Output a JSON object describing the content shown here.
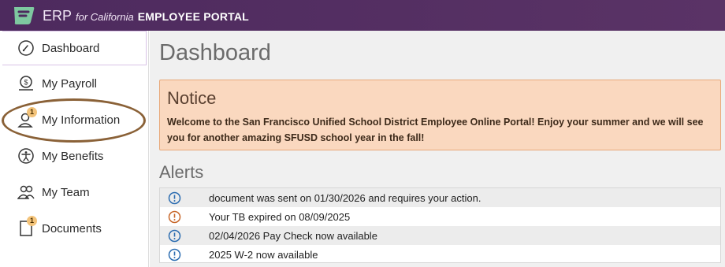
{
  "header": {
    "brand_erp": "ERP",
    "brand_ca": "for California",
    "brand_portal": "EMPLOYEE PORTAL"
  },
  "sidebar": {
    "items": [
      {
        "label": "Dashboard",
        "icon": "speedometer-icon",
        "active": true
      },
      {
        "label": "My Payroll",
        "icon": "dollar-icon"
      },
      {
        "label": "My Information",
        "icon": "user-icon",
        "badge": "1"
      },
      {
        "label": "My Benefits",
        "icon": "accessibility-icon"
      },
      {
        "label": "My Team",
        "icon": "team-icon"
      },
      {
        "label": "Documents",
        "icon": "document-icon",
        "badge": "1"
      }
    ]
  },
  "main": {
    "title": "Dashboard",
    "notice": {
      "title": "Notice",
      "text": "Welcome to the San Francisco Unified School District Employee Online Portal! Enjoy your summer and we will see you for another amazing SFUSD school year in the fall!"
    },
    "alerts_title": "Alerts",
    "alerts": [
      {
        "text": "document was sent on 01/30/2026 and requires your action.",
        "color": "#2b6cb0"
      },
      {
        "text": "Your TB expired on 08/09/2025",
        "color": "#c8672a"
      },
      {
        "text": "02/04/2026 Pay Check now available",
        "color": "#2b6cb0"
      },
      {
        "text": "2025 W-2 now available",
        "color": "#2b6cb0"
      }
    ]
  },
  "colors": {
    "header_bg": "#4d2a5e",
    "notice_bg": "#fad8bf",
    "highlight_circle": "#8a6137"
  }
}
